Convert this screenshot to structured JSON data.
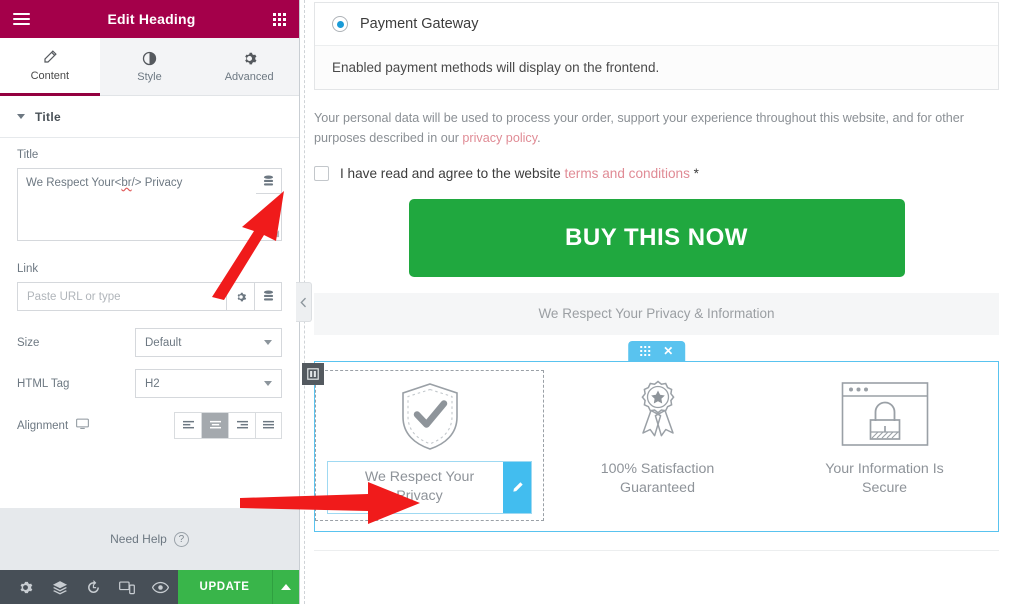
{
  "panel": {
    "header": {
      "title": "Edit Heading",
      "menu_icon": "hamburger-icon",
      "widgets_icon": "grid-dots-icon"
    },
    "tabs": [
      {
        "label": "Content",
        "icon": "pencil-icon",
        "active": true
      },
      {
        "label": "Style",
        "icon": "contrast-circle-icon",
        "active": false
      },
      {
        "label": "Advanced",
        "icon": "gear-icon",
        "active": false
      }
    ],
    "section": {
      "title": "Title",
      "collapsed": false
    },
    "controls": {
      "title_label": "Title",
      "title_value": "We Respect Your<br/> Privacy",
      "title_value_before": "We Respect Your<",
      "title_value_spell": "br",
      "title_value_after": "/> Privacy",
      "dynamic_tag_icon": "database-icon",
      "link_label": "Link",
      "link_placeholder": "Paste URL or type",
      "link_value": "",
      "link_settings_icon": "gear-icon",
      "link_dynamic_icon": "database-icon",
      "size_label": "Size",
      "size_value": "Default",
      "html_tag_label": "HTML Tag",
      "html_tag_value": "H2",
      "alignment_label": "Alignment",
      "alignment_device_icon": "desktop-icon",
      "alignment_options": [
        "left",
        "center",
        "right",
        "justify"
      ],
      "alignment_selected": "center"
    },
    "need_help": {
      "label": "Need Help",
      "icon": "question-circle-icon"
    },
    "footer": {
      "icons": [
        {
          "name": "settings-gear-icon"
        },
        {
          "name": "navigator-layers-icon"
        },
        {
          "name": "history-icon"
        },
        {
          "name": "responsive-mode-icon"
        },
        {
          "name": "preview-eye-icon"
        }
      ],
      "update_label": "UPDATE",
      "update_caret_icon": "caret-up-icon"
    },
    "collapse_icon": "chevron-left-icon"
  },
  "preview": {
    "payment": {
      "option_label": "Payment Gateway",
      "option_selected": true,
      "note": "Enabled payment methods will display on the frontend."
    },
    "privacy_notice": {
      "text_before": "Your personal data will be used to process your order, support your experience throughout this website, and for other purposes described in our ",
      "link": "privacy policy",
      "text_after": "."
    },
    "terms": {
      "checked": false,
      "text_before": "I have read and agree to the website ",
      "link": "terms and conditions",
      "text_after": " *"
    },
    "buy_button": {
      "label": "BUY THIS NOW"
    },
    "reassurance_bar": {
      "text": "We Respect Your Privacy & Information"
    },
    "section_handle": {
      "drag_icon": "grid-dots-icon",
      "close_icon": "close-x-icon"
    },
    "column_handle": {
      "icon": "column-handle-icon"
    },
    "badges": [
      {
        "icon": "shield-check-icon",
        "caption_line1": "We Respect Your",
        "caption_line2": "Privacy",
        "selected": true,
        "edit_icon": "pencil-edit-icon"
      },
      {
        "icon": "award-ribbon-icon",
        "caption_line1": "100% Satisfaction",
        "caption_line2": "Guaranteed",
        "selected": false
      },
      {
        "icon": "browser-lock-icon",
        "caption_line1": "Your Information Is",
        "caption_line2": "Secure",
        "selected": false
      }
    ]
  },
  "colors": {
    "panel_header": "#a4004a",
    "accent_blue": "#59c3ef",
    "buy_green": "#20a83f",
    "update_green": "#39b54a",
    "link_pink": "#e08b95",
    "footer_dark": "#474f57",
    "arrow_red": "#f01b1b"
  }
}
